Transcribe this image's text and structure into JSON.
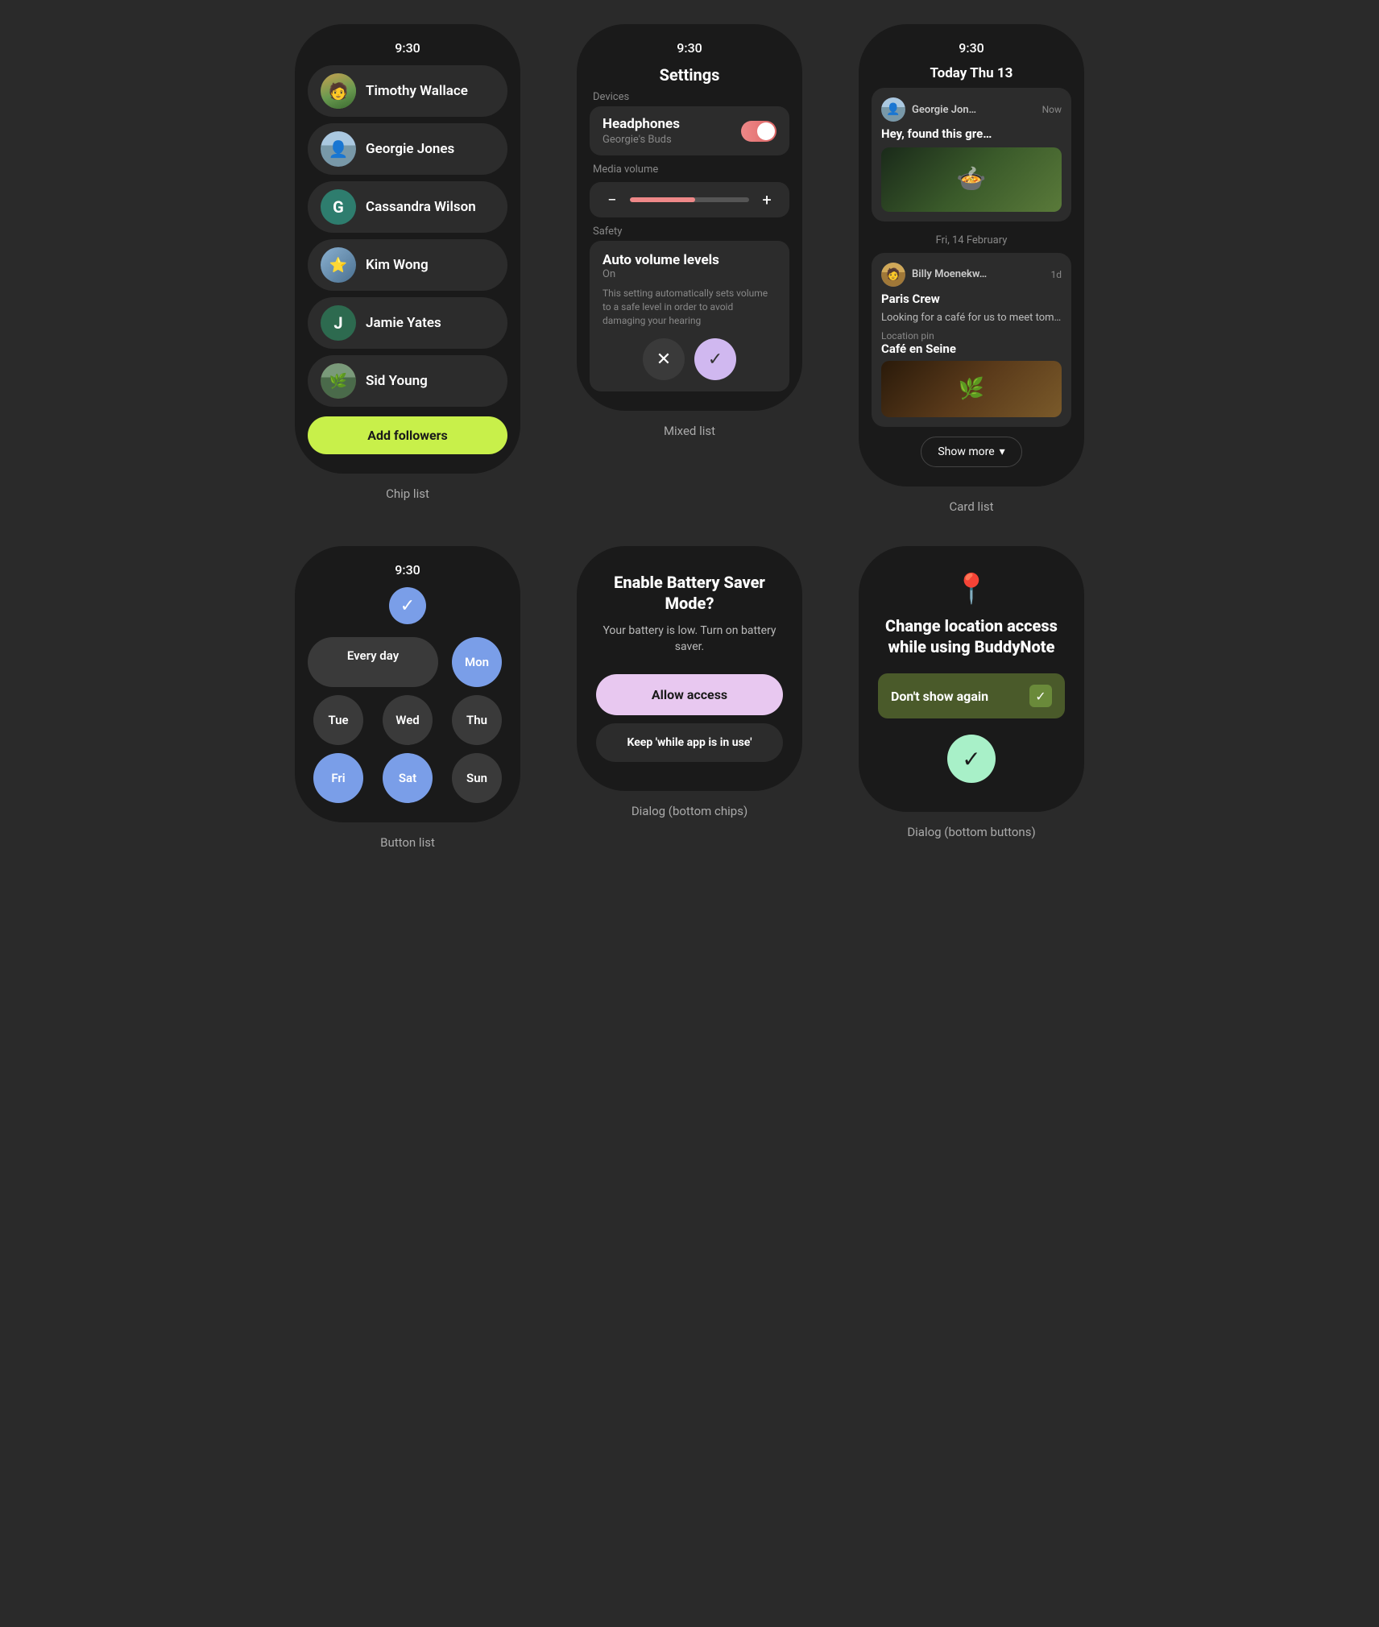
{
  "grid": {
    "cells": [
      {
        "id": "chip-list",
        "label": "Chip list",
        "time": "9:30",
        "contacts": [
          {
            "name": "Timothy Wallace",
            "avatar_type": "image",
            "avatar_char": "🧑",
            "avatar_class": "av-timothy"
          },
          {
            "name": "Georgie Jones",
            "avatar_type": "image",
            "avatar_char": "👤",
            "avatar_class": "av-georgie"
          },
          {
            "name": "Cassandra Wilson",
            "avatar_type": "letter",
            "avatar_char": "G",
            "avatar_class": "av-cassandra"
          },
          {
            "name": "Kim Wong",
            "avatar_type": "image",
            "avatar_char": "⭐",
            "avatar_class": "av-kim"
          },
          {
            "name": "Jamie Yates",
            "avatar_type": "letter",
            "avatar_char": "J",
            "avatar_class": "av-jamie"
          },
          {
            "name": "Sid Young",
            "avatar_type": "image",
            "avatar_char": "🌿",
            "avatar_class": "av-sid"
          }
        ],
        "add_button": "Add followers"
      },
      {
        "id": "mixed-list",
        "label": "Mixed list",
        "time": "9:30",
        "title": "Settings",
        "devices_label": "Devices",
        "device_name": "Headphones",
        "device_sub": "Georgie's Buds",
        "volume_label": "Media volume",
        "volume_percent": 55,
        "safety_label": "Safety",
        "safety_name": "Auto volume levels",
        "safety_state": "On",
        "safety_desc": "This setting automatically sets volume to a safe level in order to avoid damaging your hearing"
      },
      {
        "id": "card-list",
        "label": "Card list",
        "time": "9:30",
        "date_today": "Today Thu 13",
        "cards": [
          {
            "sender": "Georgie Jon…",
            "time": "Now",
            "text": "Hey, found this gre…",
            "has_image": true
          }
        ],
        "date_divider": "Fri, 14 February",
        "cards2": [
          {
            "sender": "Billy Moenekw…",
            "time": "1d",
            "title": "Paris Crew",
            "text": "Looking for a café for us to meet tom…",
            "location_label": "Location pin",
            "location_name": "Café en Seine",
            "has_location_image": true
          }
        ],
        "show_more": "Show more"
      },
      {
        "id": "button-list",
        "label": "Button list",
        "time": "9:30",
        "days": [
          {
            "label": "Every day",
            "span": 2,
            "active": false
          },
          {
            "label": "Mon",
            "active": true
          },
          {
            "label": "Tue",
            "active": false
          },
          {
            "label": "Wed",
            "active": false
          },
          {
            "label": "Thu",
            "active": false
          },
          {
            "label": "Fri",
            "active": true
          },
          {
            "label": "Sat",
            "active": true
          },
          {
            "label": "Sun",
            "active": false
          }
        ]
      },
      {
        "id": "dialog-chips",
        "label": "Dialog (bottom chips)",
        "title": "Enable Battery Saver Mode?",
        "desc": "Your battery is low. Turn on battery saver.",
        "btn_primary": "Allow access",
        "btn_secondary": "Keep 'while app is in use'"
      },
      {
        "id": "dialog-buttons",
        "label": "Dialog (bottom buttons)",
        "title": "Change location access while using BuddyNote",
        "dont_show": "Don't show again",
        "confirm_icon": "✓"
      }
    ]
  }
}
